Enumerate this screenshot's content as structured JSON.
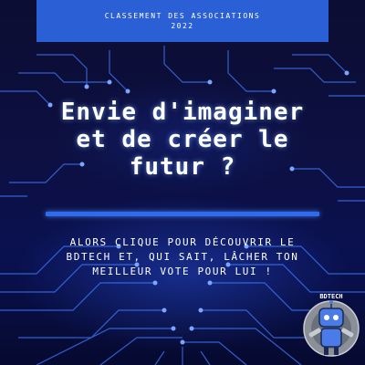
{
  "banner": {
    "line1": "Classement des associations",
    "line2": "2022"
  },
  "title": {
    "line1": "Envie d'imaginer",
    "line2": "et de créer le",
    "line3": "futur ?"
  },
  "cta": {
    "line1": "Alors clique pour découvrir le",
    "line2": "BDTECH et, qui sait, lâcher ton",
    "line3": "meilleur vote pour lui !"
  },
  "logo": {
    "text": "BDTECH",
    "icon": "robot-mascot-icon"
  },
  "colors": {
    "background": "#0b0d33",
    "banner": "#2a5fd6",
    "divider": "#2d6cf0",
    "circuit": "#3f7bff",
    "text": "#ffffff"
  }
}
